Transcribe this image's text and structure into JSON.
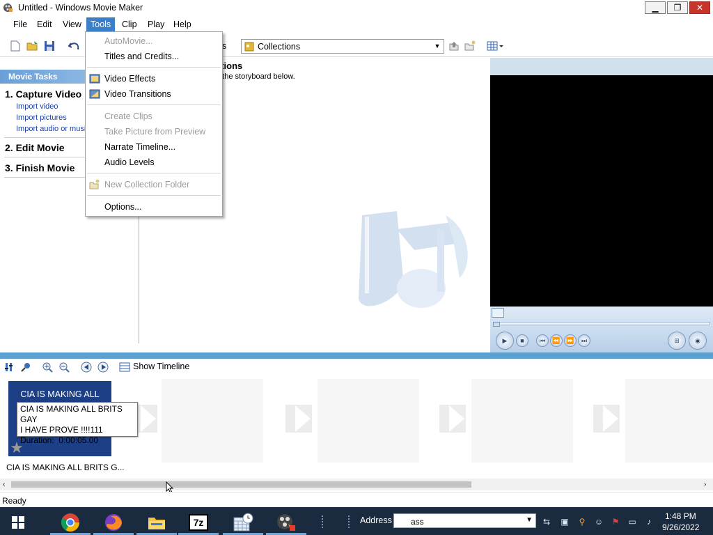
{
  "window": {
    "title": "Untitled - Windows Movie Maker",
    "app_icon": "movie-maker-icon",
    "controls": {
      "minimize": "minimize-icon",
      "restore": "restore-icon",
      "close": "close-icon"
    }
  },
  "menubar": {
    "items": [
      "File",
      "Edit",
      "View",
      "Tools",
      "Clip",
      "Play",
      "Help"
    ],
    "active": "Tools"
  },
  "toolbar": {
    "partial_label": "ns",
    "collections_value": "Collections"
  },
  "task_pane": {
    "header": "Movie Tasks",
    "sections": [
      {
        "heading": "1. Capture Video",
        "links": [
          "Import video",
          "Import pictures",
          "Import audio or music"
        ]
      },
      {
        "heading": "2. Edit Movie",
        "links": []
      },
      {
        "heading": "3. Finish Movie",
        "links": []
      }
    ]
  },
  "collection": {
    "title_partial": "ctions",
    "subtitle_partial": "n the storyboard below."
  },
  "tools_menu": {
    "items": [
      {
        "label": "AutoMovie...",
        "disabled": true,
        "icon": ""
      },
      {
        "label": "Titles and Credits...",
        "disabled": false,
        "icon": ""
      },
      {
        "label": "Video Effects",
        "disabled": false,
        "icon": "video-effects-icon"
      },
      {
        "label": "Video Transitions",
        "disabled": false,
        "icon": "video-transitions-icon"
      },
      {
        "label": "Create Clips",
        "disabled": true,
        "icon": ""
      },
      {
        "label": "Take Picture from Preview",
        "disabled": true,
        "icon": ""
      },
      {
        "label": "Narrate Timeline...",
        "disabled": false,
        "icon": ""
      },
      {
        "label": "Audio Levels",
        "disabled": false,
        "icon": ""
      },
      {
        "label": "New Collection Folder",
        "disabled": true,
        "icon": "new-folder-icon"
      },
      {
        "label": "Options...",
        "disabled": false,
        "icon": ""
      }
    ]
  },
  "storyboard": {
    "show_timeline_label": "Show Timeline",
    "clip": {
      "thumb_text": "CIA IS MAKING ALL",
      "tooltip_lines": [
        "CIA IS MAKING ALL BRITS GAY",
        "I HAVE PROVE !!!!111",
        "Duration:  0:00:05.00"
      ],
      "caption": "CIA IS MAKING ALL BRITS G..."
    }
  },
  "status": {
    "text": "Ready"
  },
  "taskbar": {
    "apps": [
      "start-icon",
      "chrome-icon",
      "firefox-icon",
      "file-explorer-icon",
      "7zip-icon",
      "calendar-clock-icon",
      "movie-maker-icon"
    ],
    "app_7z_label": "7z",
    "address_label": "Address",
    "address_value": "ass",
    "clock_time": "1:48 PM",
    "clock_date": "9/26/2022"
  },
  "colors": {
    "menu_highlight": "#3a7fc8",
    "split_bar": "#5ba0d0",
    "clip_thumb": "#1c3f86",
    "taskbar": "#1a2b3f",
    "close_button": "#c7352b"
  }
}
